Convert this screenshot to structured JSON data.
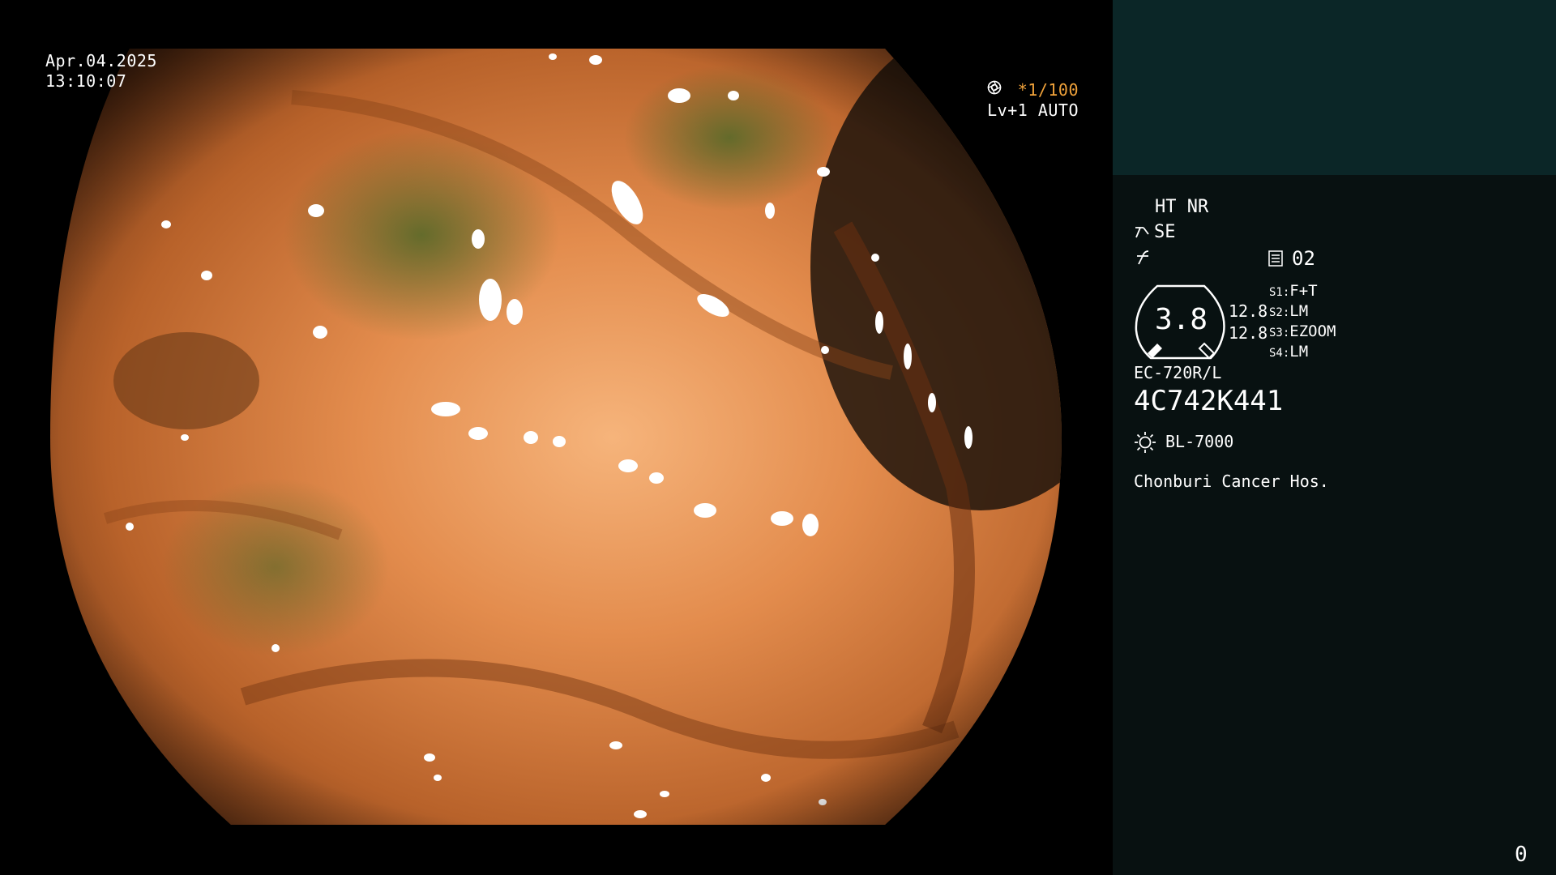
{
  "scope": {
    "date": "Apr.04.2025",
    "time": "13:10:07",
    "shutter": "1/100",
    "shutter_prefix": "*",
    "level_mode": "Lv+1 AUTO"
  },
  "panel": {
    "ht_nr": "HT NR",
    "se": "SE",
    "record_no": "02",
    "gauge_value": "3.8",
    "val_top": "12.8",
    "val_bottom": "12.8",
    "switches": [
      {
        "key": "S1:",
        "value": "F+T"
      },
      {
        "key": "S2:",
        "value": "LM"
      },
      {
        "key": "S3:",
        "value": "EZOOM"
      },
      {
        "key": "S4:",
        "value": "LM"
      }
    ],
    "model": "EC-720R/L",
    "serial": "4C742K441",
    "light_source": "BL-7000",
    "hospital": "Chonburi Cancer Hos.",
    "counter": "0"
  },
  "colors": {
    "panel_bg": "#081111",
    "panel_header_bg": "#0b2627",
    "accent_orange": "#f0a23a"
  },
  "icons": [
    "aperture-icon",
    "iris-icon",
    "scissors-icon",
    "electrical-icon",
    "memory-icon",
    "light-source-icon"
  ]
}
